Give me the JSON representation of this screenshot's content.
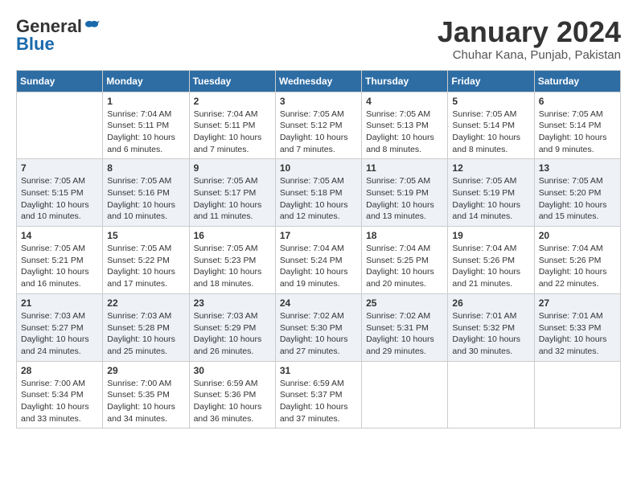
{
  "header": {
    "logo_general": "General",
    "logo_blue": "Blue",
    "month_title": "January 2024",
    "location": "Chuhar Kana, Punjab, Pakistan"
  },
  "days_of_week": [
    "Sunday",
    "Monday",
    "Tuesday",
    "Wednesday",
    "Thursday",
    "Friday",
    "Saturday"
  ],
  "weeks": [
    [
      {
        "day": "",
        "info": ""
      },
      {
        "day": "1",
        "info": "Sunrise: 7:04 AM\nSunset: 5:11 PM\nDaylight: 10 hours\nand 6 minutes."
      },
      {
        "day": "2",
        "info": "Sunrise: 7:04 AM\nSunset: 5:11 PM\nDaylight: 10 hours\nand 7 minutes."
      },
      {
        "day": "3",
        "info": "Sunrise: 7:05 AM\nSunset: 5:12 PM\nDaylight: 10 hours\nand 7 minutes."
      },
      {
        "day": "4",
        "info": "Sunrise: 7:05 AM\nSunset: 5:13 PM\nDaylight: 10 hours\nand 8 minutes."
      },
      {
        "day": "5",
        "info": "Sunrise: 7:05 AM\nSunset: 5:14 PM\nDaylight: 10 hours\nand 8 minutes."
      },
      {
        "day": "6",
        "info": "Sunrise: 7:05 AM\nSunset: 5:14 PM\nDaylight: 10 hours\nand 9 minutes."
      }
    ],
    [
      {
        "day": "7",
        "info": "Sunrise: 7:05 AM\nSunset: 5:15 PM\nDaylight: 10 hours\nand 10 minutes."
      },
      {
        "day": "8",
        "info": "Sunrise: 7:05 AM\nSunset: 5:16 PM\nDaylight: 10 hours\nand 10 minutes."
      },
      {
        "day": "9",
        "info": "Sunrise: 7:05 AM\nSunset: 5:17 PM\nDaylight: 10 hours\nand 11 minutes."
      },
      {
        "day": "10",
        "info": "Sunrise: 7:05 AM\nSunset: 5:18 PM\nDaylight: 10 hours\nand 12 minutes."
      },
      {
        "day": "11",
        "info": "Sunrise: 7:05 AM\nSunset: 5:19 PM\nDaylight: 10 hours\nand 13 minutes."
      },
      {
        "day": "12",
        "info": "Sunrise: 7:05 AM\nSunset: 5:19 PM\nDaylight: 10 hours\nand 14 minutes."
      },
      {
        "day": "13",
        "info": "Sunrise: 7:05 AM\nSunset: 5:20 PM\nDaylight: 10 hours\nand 15 minutes."
      }
    ],
    [
      {
        "day": "14",
        "info": "Sunrise: 7:05 AM\nSunset: 5:21 PM\nDaylight: 10 hours\nand 16 minutes."
      },
      {
        "day": "15",
        "info": "Sunrise: 7:05 AM\nSunset: 5:22 PM\nDaylight: 10 hours\nand 17 minutes."
      },
      {
        "day": "16",
        "info": "Sunrise: 7:05 AM\nSunset: 5:23 PM\nDaylight: 10 hours\nand 18 minutes."
      },
      {
        "day": "17",
        "info": "Sunrise: 7:04 AM\nSunset: 5:24 PM\nDaylight: 10 hours\nand 19 minutes."
      },
      {
        "day": "18",
        "info": "Sunrise: 7:04 AM\nSunset: 5:25 PM\nDaylight: 10 hours\nand 20 minutes."
      },
      {
        "day": "19",
        "info": "Sunrise: 7:04 AM\nSunset: 5:26 PM\nDaylight: 10 hours\nand 21 minutes."
      },
      {
        "day": "20",
        "info": "Sunrise: 7:04 AM\nSunset: 5:26 PM\nDaylight: 10 hours\nand 22 minutes."
      }
    ],
    [
      {
        "day": "21",
        "info": "Sunrise: 7:03 AM\nSunset: 5:27 PM\nDaylight: 10 hours\nand 24 minutes."
      },
      {
        "day": "22",
        "info": "Sunrise: 7:03 AM\nSunset: 5:28 PM\nDaylight: 10 hours\nand 25 minutes."
      },
      {
        "day": "23",
        "info": "Sunrise: 7:03 AM\nSunset: 5:29 PM\nDaylight: 10 hours\nand 26 minutes."
      },
      {
        "day": "24",
        "info": "Sunrise: 7:02 AM\nSunset: 5:30 PM\nDaylight: 10 hours\nand 27 minutes."
      },
      {
        "day": "25",
        "info": "Sunrise: 7:02 AM\nSunset: 5:31 PM\nDaylight: 10 hours\nand 29 minutes."
      },
      {
        "day": "26",
        "info": "Sunrise: 7:01 AM\nSunset: 5:32 PM\nDaylight: 10 hours\nand 30 minutes."
      },
      {
        "day": "27",
        "info": "Sunrise: 7:01 AM\nSunset: 5:33 PM\nDaylight: 10 hours\nand 32 minutes."
      }
    ],
    [
      {
        "day": "28",
        "info": "Sunrise: 7:00 AM\nSunset: 5:34 PM\nDaylight: 10 hours\nand 33 minutes."
      },
      {
        "day": "29",
        "info": "Sunrise: 7:00 AM\nSunset: 5:35 PM\nDaylight: 10 hours\nand 34 minutes."
      },
      {
        "day": "30",
        "info": "Sunrise: 6:59 AM\nSunset: 5:36 PM\nDaylight: 10 hours\nand 36 minutes."
      },
      {
        "day": "31",
        "info": "Sunrise: 6:59 AM\nSunset: 5:37 PM\nDaylight: 10 hours\nand 37 minutes."
      },
      {
        "day": "",
        "info": ""
      },
      {
        "day": "",
        "info": ""
      },
      {
        "day": "",
        "info": ""
      }
    ]
  ]
}
